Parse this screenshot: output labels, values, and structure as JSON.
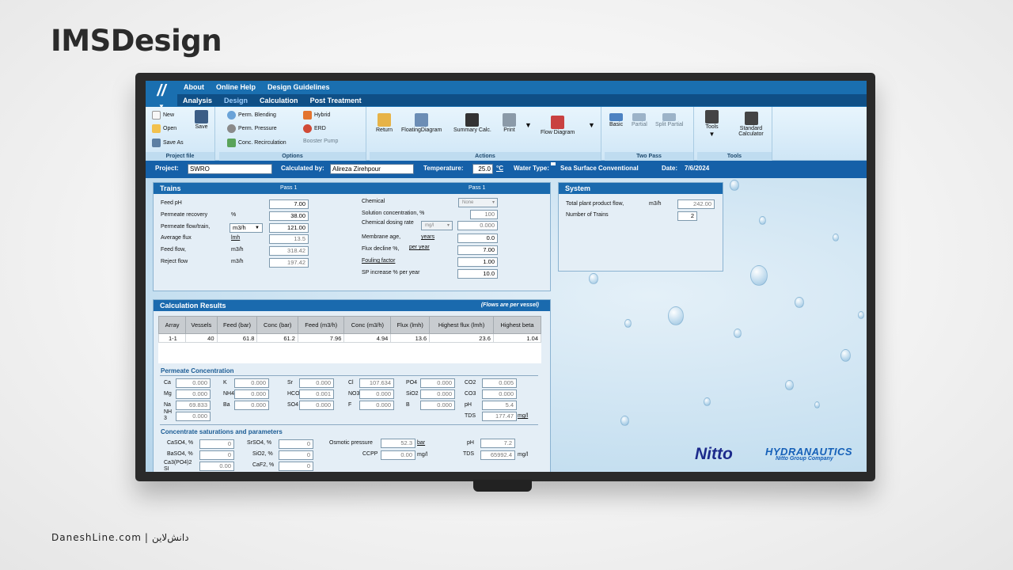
{
  "page": {
    "brand": "IMSDesign",
    "footer_site": "DaneshLine.com",
    "footer_sep": "|",
    "footer_fa": "دانش‌لاین"
  },
  "menu": {
    "top": [
      "About",
      "Online Help",
      "Design Guidelines"
    ],
    "tabs": [
      "Analysis",
      "Design",
      "Calculation",
      "Post Treatment"
    ],
    "active_tab": "Design"
  },
  "ribbon": {
    "project": {
      "new": "New",
      "open": "Open",
      "save_as": "Save As",
      "save": "Save",
      "group": "Project file"
    },
    "options": {
      "perm_blending": "Perm. Blending",
      "perm_pressure": "Perm. Pressure",
      "conc_recirc": "Conc. Recirculation",
      "hybrid": "Hybrid",
      "erd": "ERD",
      "booster": "Booster Pump",
      "group": "Options"
    },
    "actions": {
      "return": "Return",
      "floating": "FloatingDiagram",
      "summary": "Summary Calc.",
      "print": "Print",
      "flow": "Flow Diagram",
      "group": "Actions"
    },
    "twopass": {
      "basic": "Basic",
      "partial": "Partial",
      "split": "Split Partial",
      "group": "Two Pass"
    },
    "tools": {
      "tools": "Tools",
      "std_calc": "Standard Calculator",
      "group": "Tools"
    }
  },
  "infobar": {
    "project_label": "Project:",
    "project": "SWRO",
    "calc_label": "Calculated by:",
    "calc_by": "Alireza Zirehpour",
    "temp_label": "Temperature:",
    "temp": "25.0",
    "temp_unit": "°C",
    "water_label": "Water Type:",
    "water": "Sea Surface Conventional",
    "date_label": "Date:",
    "date": "7/6/2024"
  },
  "trains": {
    "title": "Trains",
    "pass_left": "Pass 1",
    "pass_right": "Pass 1",
    "left": [
      {
        "label": "Feed pH",
        "unit": "",
        "value": "7.00"
      },
      {
        "label": "Permeate recovery",
        "unit": "%",
        "value": "38.00"
      },
      {
        "label": "Permeate flow/train,",
        "unit": "m3/h",
        "value": "121.00"
      },
      {
        "label": "Average flux",
        "unit": "lmh",
        "value": "13.5"
      },
      {
        "label": "Feed flow,",
        "unit": "m3/h",
        "value": "318.42"
      },
      {
        "label": "Reject flow",
        "unit": "m3/h",
        "value": "197.42"
      }
    ],
    "chemical_label": "Chemical",
    "chemical": "None",
    "sol_label": "Solution concentration, %",
    "sol": "100",
    "dose_label": "Chemical dosing rate",
    "dose_unit": "mg/l",
    "dose": "0.000",
    "age_label": "Membrane age,",
    "age_unit": "years",
    "age": "0.0",
    "decline_label": "Flux decline %,",
    "decline_unit": "per year",
    "decline": "7.00",
    "fouling_label": "Fouling factor",
    "fouling": "1.00",
    "sp_label": "SP increase % per year",
    "sp": "10.0"
  },
  "system": {
    "title": "System",
    "total_label": "Total plant product flow,",
    "total_unit": "m3/h",
    "total": "242.00",
    "trains_label": "Number of Trains",
    "trains": "2"
  },
  "results": {
    "title": "Calculation Results",
    "note": "(Flows are per vessel)",
    "headers": [
      "Array",
      "Vessels",
      "Feed (bar)",
      "Conc (bar)",
      "Feed (m3/h)",
      "Conc (m3/h)",
      "Flux (lmh)",
      "Highest flux (lmh)",
      "Highest beta"
    ],
    "row": [
      "1-1",
      "40",
      "61.8",
      "61.2",
      "7.96",
      "4.94",
      "13.6",
      "23.6",
      "1.04"
    ]
  },
  "permeate": {
    "title": "Permeate Concentration",
    "cells": [
      {
        "l": "Ca",
        "v": "0.000"
      },
      {
        "l": "K",
        "v": "0.000"
      },
      {
        "l": "Sr",
        "v": "0.000"
      },
      {
        "l": "Cl",
        "v": "107.634"
      },
      {
        "l": "PO4",
        "v": "0.000"
      },
      {
        "l": "CO2",
        "v": "0.005"
      },
      {
        "l": "Mg",
        "v": "0.000"
      },
      {
        "l": "NH4",
        "v": "0.000"
      },
      {
        "l": "HCO3",
        "v": "0.001"
      },
      {
        "l": "NO3",
        "v": "0.000"
      },
      {
        "l": "SiO2",
        "v": "0.000"
      },
      {
        "l": "CO3",
        "v": "0.000"
      },
      {
        "l": "Na",
        "v": "69.833"
      },
      {
        "l": "Ba",
        "v": "0.000"
      },
      {
        "l": "SO4",
        "v": "0.000"
      },
      {
        "l": "F",
        "v": "0.000"
      },
      {
        "l": "B",
        "v": "0.000"
      },
      {
        "l": "pH",
        "v": "5.4"
      }
    ],
    "nh3_label": "NH\n3",
    "nh3": "0.000",
    "tds_label": "TDS",
    "tds": "177.47",
    "tds_unit": "mg/l"
  },
  "concentrate": {
    "title": "Concentrate saturations and parameters",
    "caso4_label": "CaSO4, %",
    "caso4": "0",
    "srso4_label": "SrSO4, %",
    "srso4": "0",
    "baso4_label": "BaSO4, %",
    "baso4": "0",
    "sio2_label": "SiO2, %",
    "sio2": "0",
    "capo4_label": "Ca3(PO4)2 SI",
    "capo4": "0.00",
    "caf2_label": "CaF2, %",
    "caf2": "0",
    "osm_label": "Osmotic pressure",
    "osm": "52.3",
    "osm_unit": "bar",
    "ccpp_label": "CCPP",
    "ccpp": "0.00",
    "ccpp_unit": "mg/l",
    "ph_label": "pH",
    "ph": "7.2",
    "tds_label": "TDS",
    "tds": "65992.4",
    "tds_unit": "mg/l"
  },
  "logos": {
    "nitto": "Nitto",
    "hydranautics": "HYDRANAUTICS",
    "hydranautics_sub": "Nitto Group Company"
  }
}
